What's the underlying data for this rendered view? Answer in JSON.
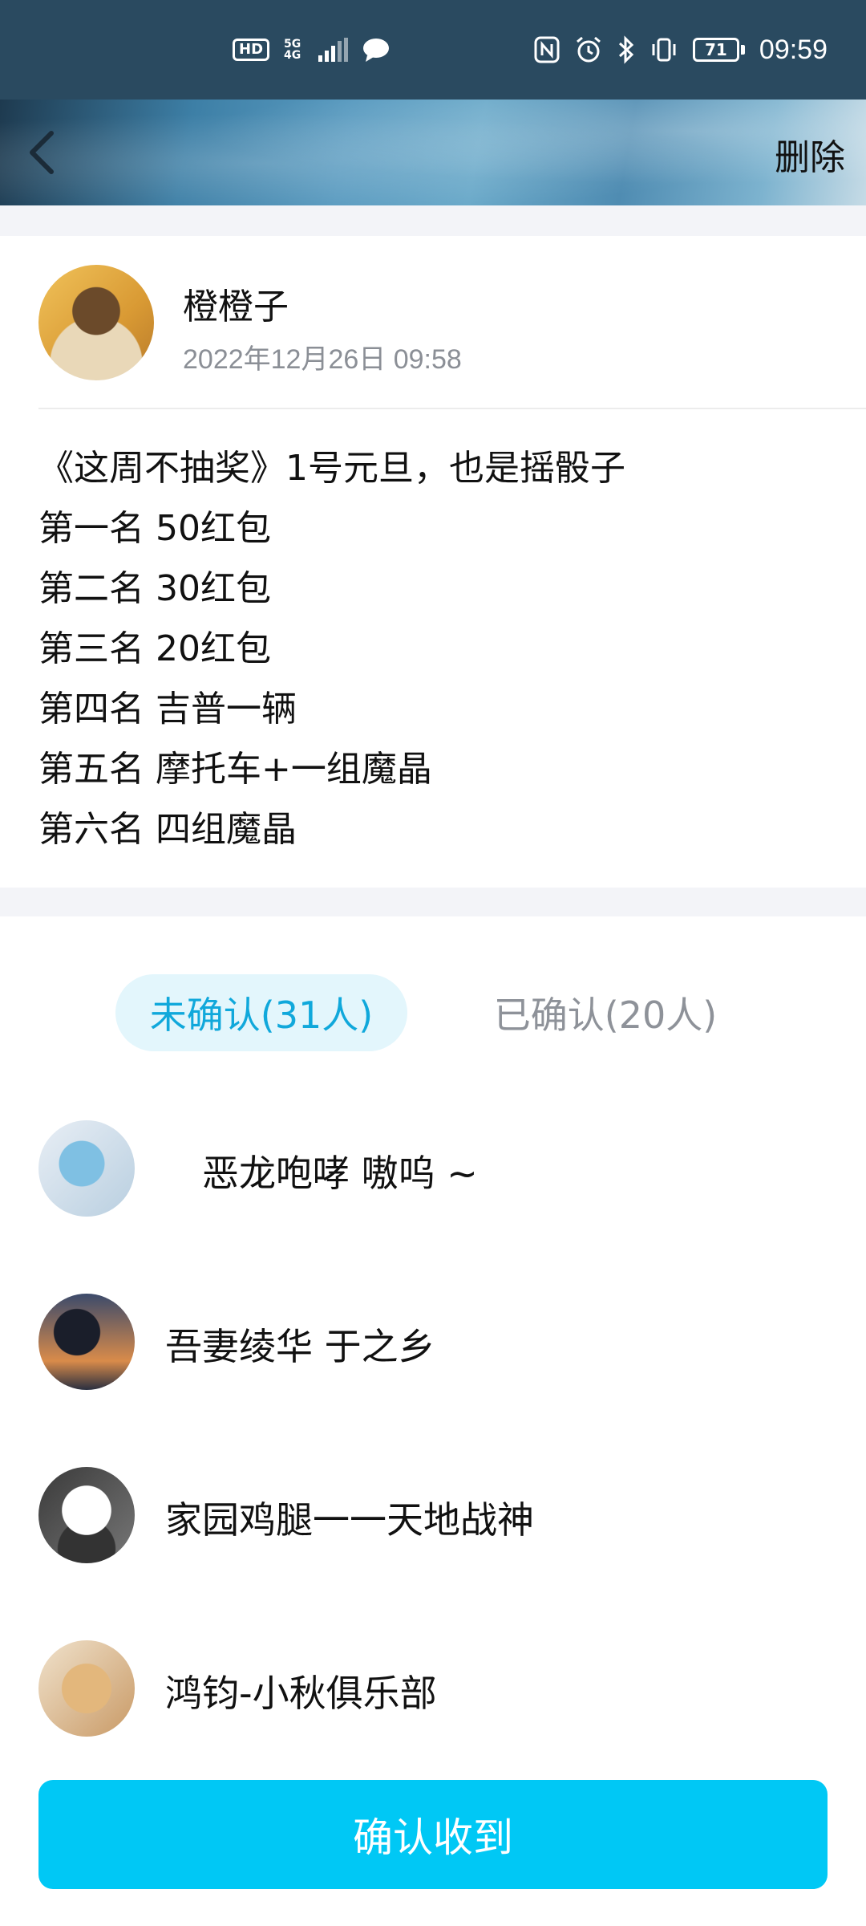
{
  "status_bar": {
    "hd": "HD",
    "network": "5G",
    "network_sub": "4G",
    "battery": "71",
    "time": "09:59"
  },
  "header": {
    "back_icon": "chevron-left-icon",
    "delete_label": "删除"
  },
  "post": {
    "author": "橙橙子",
    "time": "2022年12月26日 09:58",
    "lines": [
      "《这周不抽奖》1号元旦，也是摇骰子",
      "第一名 50红包",
      "第二名 30红包",
      "第三名 20红包",
      "第四名 吉普一辆",
      "第五名 摩托车+一组魔晶",
      "第六名 四组魔晶"
    ]
  },
  "tabs": {
    "unconfirmed": "未确认(31人)",
    "confirmed": "已确认(20人)"
  },
  "members": [
    {
      "name": "恶龙咆哮 嗷呜 ~"
    },
    {
      "name": "吾妻绫华 于之乡"
    },
    {
      "name": "家园鸡腿一一天地战神"
    },
    {
      "name": "鸿钧-小秋俱乐部"
    }
  ],
  "confirm_button": "确认收到",
  "colors": {
    "status_bar": "#2a4a60",
    "accent": "#00c8f5",
    "tab_active_text": "#10a8db",
    "tab_active_bg": "#e3f6fc",
    "muted_text": "#8b8f96"
  }
}
